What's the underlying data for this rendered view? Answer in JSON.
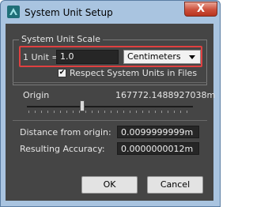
{
  "window": {
    "title": "System Unit Setup",
    "close_label": "X"
  },
  "unit_scale": {
    "group_label": "System Unit Scale",
    "unit_label": "1 Unit =",
    "unit_value": "1.0",
    "unit_type": "Centimeters",
    "respect_label": "Respect System Units in Files",
    "respect_checked": "✔"
  },
  "origin": {
    "label": "Origin",
    "value": "167772.1488927038m",
    "distance_label": "Distance from origin:",
    "distance_value": "0.0099999999m",
    "accuracy_label": "Resulting Accuracy:",
    "accuracy_value": "0.0000000012m"
  },
  "buttons": {
    "ok": "OK",
    "cancel": "Cancel"
  },
  "colors": {
    "dialog_bg": "#454545",
    "highlight": "#e04040",
    "title_bar": "#a9c4e0"
  }
}
